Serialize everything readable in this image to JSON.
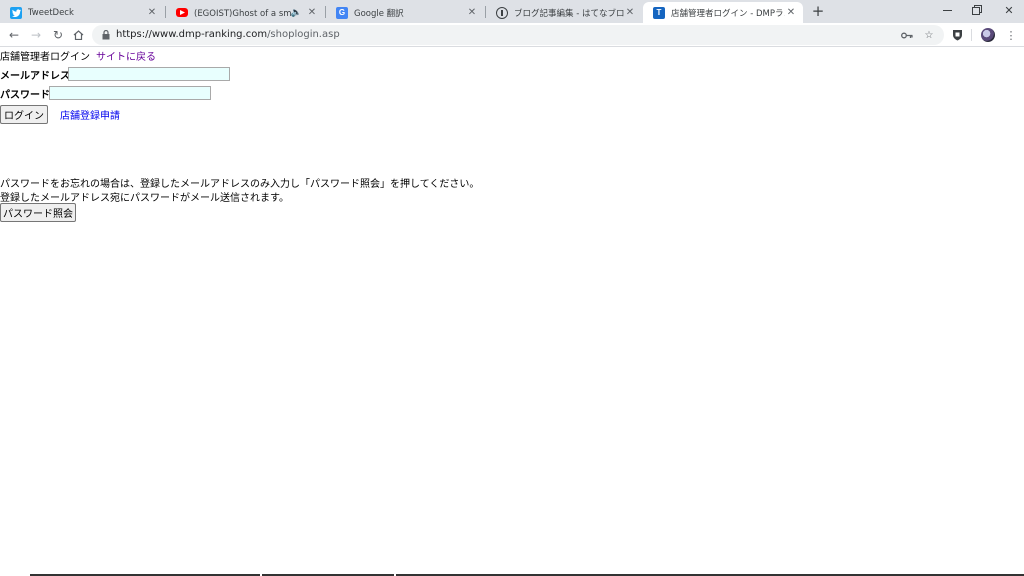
{
  "browser": {
    "tabs": [
      {
        "title": "TweetDeck",
        "icon": "twitter-bird-icon",
        "color": "#1da1f2"
      },
      {
        "title": "(EGOIST)Ghost of a smile 歌",
        "icon": "youtube-icon",
        "color": "#ff0000"
      },
      {
        "title": "Google 翻訳",
        "icon": "google-translate-icon",
        "color": "#4285f4"
      },
      {
        "title": "ブログ記事編集 - はてなブログ",
        "icon": "hatena-blog-icon",
        "color": "#3c4043"
      },
      {
        "title": "店舗管理者ログイン - DMPランキング",
        "icon": "dmp-ranking-icon",
        "color": "#1565c0"
      }
    ],
    "active_tab_index": 4,
    "new_tab_label": "+",
    "url_host": "https://www.dmp-ranking.com",
    "url_path": "/shoplogin.asp"
  },
  "page": {
    "title_text": "店舗管理者ログイン",
    "back_link": "サイトに戻る",
    "email_label": "メールアドレス",
    "password_label": "パスワード",
    "email_value": "",
    "password_value": "",
    "login_button": "ログイン",
    "register_link": "店舗登録申請",
    "forgot_line1": "パスワードをお忘れの場合は、登録したメールアドレスのみ入力し「パスワード照会」を押してください。",
    "forgot_line2": "登録したメールアドレス宛にパスワードがメール送信されます。",
    "inquiry_button": "パスワード照会"
  }
}
